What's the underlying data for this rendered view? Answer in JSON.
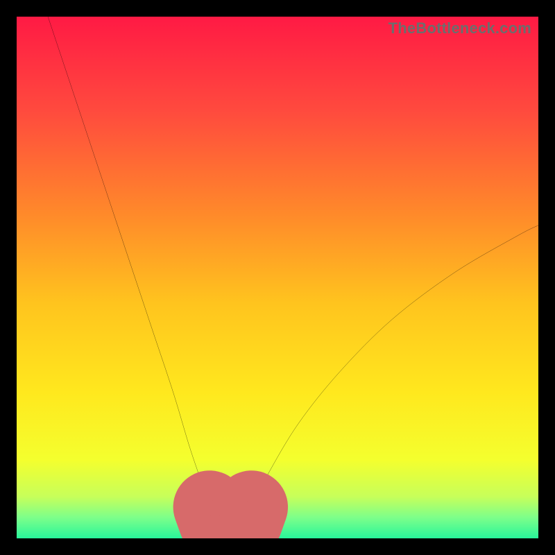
{
  "watermark": "TheBottleneck.com",
  "colors": {
    "frame": "#000000",
    "curve_stroke": "#000000",
    "minimum_marker": "#d76a6a",
    "gradient_stops": [
      {
        "offset": 0.0,
        "color": "#ff1a44"
      },
      {
        "offset": 0.18,
        "color": "#ff4a3e"
      },
      {
        "offset": 0.38,
        "color": "#ff8a2a"
      },
      {
        "offset": 0.55,
        "color": "#ffc41e"
      },
      {
        "offset": 0.72,
        "color": "#ffe81e"
      },
      {
        "offset": 0.85,
        "color": "#f4ff2e"
      },
      {
        "offset": 0.92,
        "color": "#c7ff5a"
      },
      {
        "offset": 0.96,
        "color": "#7dff8a"
      },
      {
        "offset": 1.0,
        "color": "#28f59a"
      }
    ]
  },
  "chart_data": {
    "type": "line",
    "title": "",
    "xlabel": "",
    "ylabel": "",
    "xlim": [
      0,
      100
    ],
    "ylim": [
      0,
      100
    ],
    "grid": false,
    "series": [
      {
        "name": "bottleneck-curve",
        "x": [
          6,
          10,
          14,
          18,
          22,
          26,
          30,
          33,
          35,
          37,
          38.5,
          40,
          42,
          43.5,
          45,
          48,
          54,
          62,
          72,
          84,
          96,
          100
        ],
        "y": [
          100,
          88,
          76,
          64,
          52,
          40,
          28,
          18,
          12,
          6,
          3,
          1.2,
          1.2,
          3,
          6,
          12,
          22,
          32,
          42,
          51,
          58,
          60
        ]
      }
    ],
    "annotations": [
      {
        "name": "optimal-minimum-region",
        "type": "marker-path",
        "x": [
          37,
          38,
          39,
          40,
          41,
          42,
          43,
          44,
          45
        ],
        "y": [
          6,
          3.2,
          1.8,
          1.2,
          1.2,
          1.2,
          1.8,
          3.2,
          6
        ]
      }
    ]
  }
}
